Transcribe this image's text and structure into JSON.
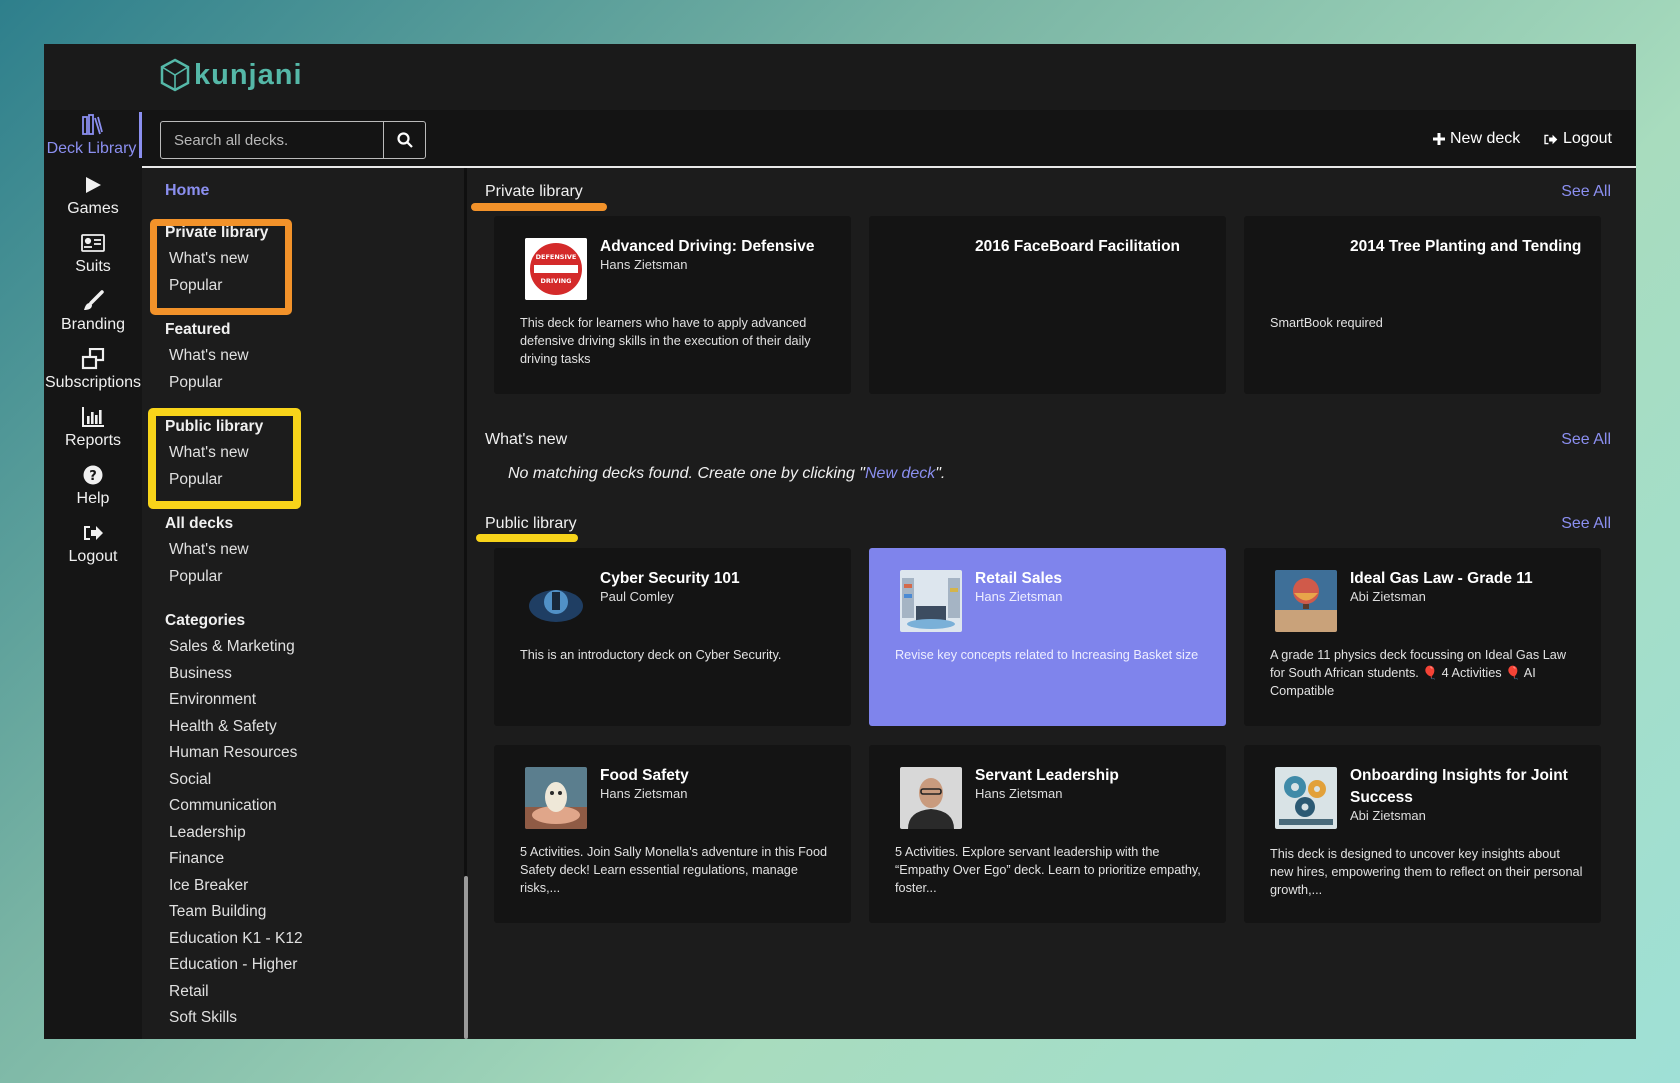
{
  "brand": {
    "logo_text": "kunjani"
  },
  "rail": [
    {
      "label": "Deck Library",
      "icon": "library-icon",
      "active": true
    },
    {
      "label": "Games",
      "icon": "play-icon"
    },
    {
      "label": "Suits",
      "icon": "id-card-icon"
    },
    {
      "label": "Branding",
      "icon": "brush-icon"
    },
    {
      "label": "Subscriptions",
      "icon": "clone-icon"
    },
    {
      "label": "Reports",
      "icon": "bar-chart-icon"
    },
    {
      "label": "Help",
      "icon": "question-circle-icon"
    },
    {
      "label": "Logout",
      "icon": "sign-out-icon"
    }
  ],
  "toolbar": {
    "search_placeholder": "Search all decks.",
    "new_deck": "New deck",
    "logout": "Logout"
  },
  "sidebar": {
    "home": "Home",
    "groups": [
      {
        "heading": "Private library",
        "items": [
          "What's new",
          "Popular"
        ]
      },
      {
        "heading": "Featured",
        "items": [
          "What's new",
          "Popular"
        ]
      },
      {
        "heading": "Public library",
        "items": [
          "What's new",
          "Popular"
        ]
      },
      {
        "heading": "All decks",
        "items": [
          "What's new",
          "Popular"
        ]
      }
    ],
    "categories_heading": "Categories",
    "categories": [
      "Sales & Marketing",
      "Business",
      "Environment",
      "Health & Safety",
      "Human Resources",
      "Social",
      "Communication",
      "Leadership",
      "Finance",
      "Ice Breaker",
      "Team Building",
      "Education K1 - K12",
      "Education - Higher",
      "Retail",
      "Soft Skills"
    ]
  },
  "main": {
    "see_all": "See All",
    "private": {
      "title": "Private library",
      "cards": [
        {
          "title": "Advanced Driving: Defensive",
          "author": "Hans Zietsman",
          "desc": "This deck for learners who have to apply advanced defensive driving skills in the execution of their daily driving tasks",
          "sign_top": "DEFENSIVE",
          "sign_bottom": "DRIVING"
        },
        {
          "title": "2016 FaceBoard Facilitation",
          "author": "",
          "desc": ""
        },
        {
          "title": "2014 Tree Planting and Tending",
          "author": "",
          "desc": "SmartBook required"
        }
      ]
    },
    "whats_new": {
      "title": "What's new",
      "empty_prefix": "No matching decks found. Create one by clicking \"",
      "empty_link": "New deck",
      "empty_suffix": "\"."
    },
    "public": {
      "title": "Public library",
      "cards": [
        {
          "title": "Cyber Security 101",
          "author": "Paul Comley",
          "desc": "This is an introductory deck on Cyber Security."
        },
        {
          "title": "Retail Sales",
          "author": "Hans Zietsman",
          "desc": "Revise key concepts related to Increasing Basket size"
        },
        {
          "title": "Ideal Gas Law - Grade 11",
          "author": "Abi Zietsman",
          "desc": "A grade 11 physics deck focussing on Ideal Gas Law for South African students. 🎈 4 Activities 🎈 AI Compatible"
        },
        {
          "title": "Food Safety",
          "author": "Hans Zietsman",
          "desc": "5 Activities. Join Sally Monella's adventure in this Food Safety deck! Learn essential regulations, manage risks,..."
        },
        {
          "title": "Servant Leadership",
          "author": "Hans Zietsman",
          "desc": "5 Activities. Explore servant leadership with the “Empathy Over Ego” deck. Learn to prioritize empathy, foster..."
        },
        {
          "title": "Onboarding Insights for Joint Success",
          "author": "Abi Zietsman",
          "desc": "This deck is designed to uncover key insights about new hires, empowering them to reflect on their personal growth,..."
        }
      ]
    }
  },
  "colors": {
    "accent": "#8b8ff0",
    "selected_card": "#7f84ec",
    "brand": "#55b8a8",
    "highlight_orange": "#f2922a",
    "highlight_yellow": "#f8d41a"
  }
}
